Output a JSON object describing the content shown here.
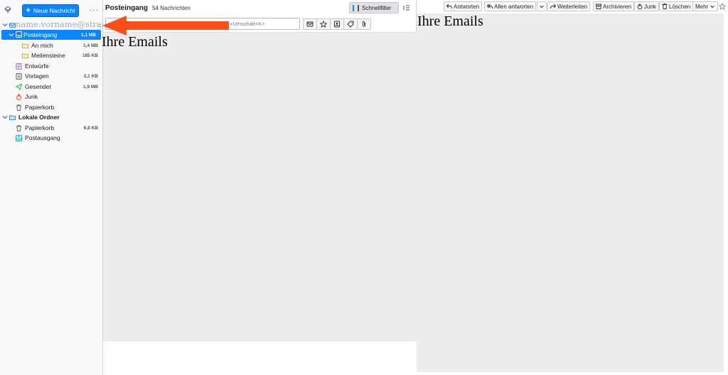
{
  "folder_pane": {
    "new_message_label": "Neue Nachricht",
    "more_label": "···",
    "account": {
      "label": "name.vorname@strand"
    },
    "folders": [
      {
        "key": "inbox",
        "label": "Posteingang",
        "size": "1,1 MB",
        "selected": true
      },
      {
        "key": "anmich",
        "label": "An mich",
        "size": "1,4 MB"
      },
      {
        "key": "meilensteine",
        "label": "Meilensteine",
        "size": "185 KB"
      },
      {
        "key": "entwuerfe",
        "label": "Entwürfe",
        "size": ""
      },
      {
        "key": "vorlagen",
        "label": "Vorlagen",
        "size": "2,1 KB"
      },
      {
        "key": "gesendet",
        "label": "Gesendet",
        "size": "1,9 MB"
      },
      {
        "key": "junk",
        "label": "Junk",
        "size": ""
      },
      {
        "key": "papierkorb",
        "label": "Papierkorb",
        "size": ""
      }
    ],
    "local": {
      "label": "Lokale Ordner",
      "folders": [
        {
          "key": "local-papierkorb",
          "label": "Papierkorb",
          "size": "6,8 KB"
        },
        {
          "key": "postausgang",
          "label": "Postausgang",
          "size": ""
        }
      ]
    }
  },
  "list_pane": {
    "title": "Posteingang",
    "count": "54 Nachrichten",
    "quickfilter_label": "Schnellfilter",
    "search_hint": "+Umschalt+K>",
    "body_title": "Ihre Emails"
  },
  "reader": {
    "buttons": {
      "reply": "Antworten",
      "reply_all": "Allen antworten",
      "forward": "Weiterleiten",
      "archive": "Archivieren",
      "junk": "Junk",
      "delete": "Löschen",
      "more": "Mehr"
    },
    "body_title": "Ihre Emails"
  },
  "colors": {
    "accent": "#0a84ff",
    "arrow": "#ff4d1a",
    "pane_gray": "#ededed"
  }
}
